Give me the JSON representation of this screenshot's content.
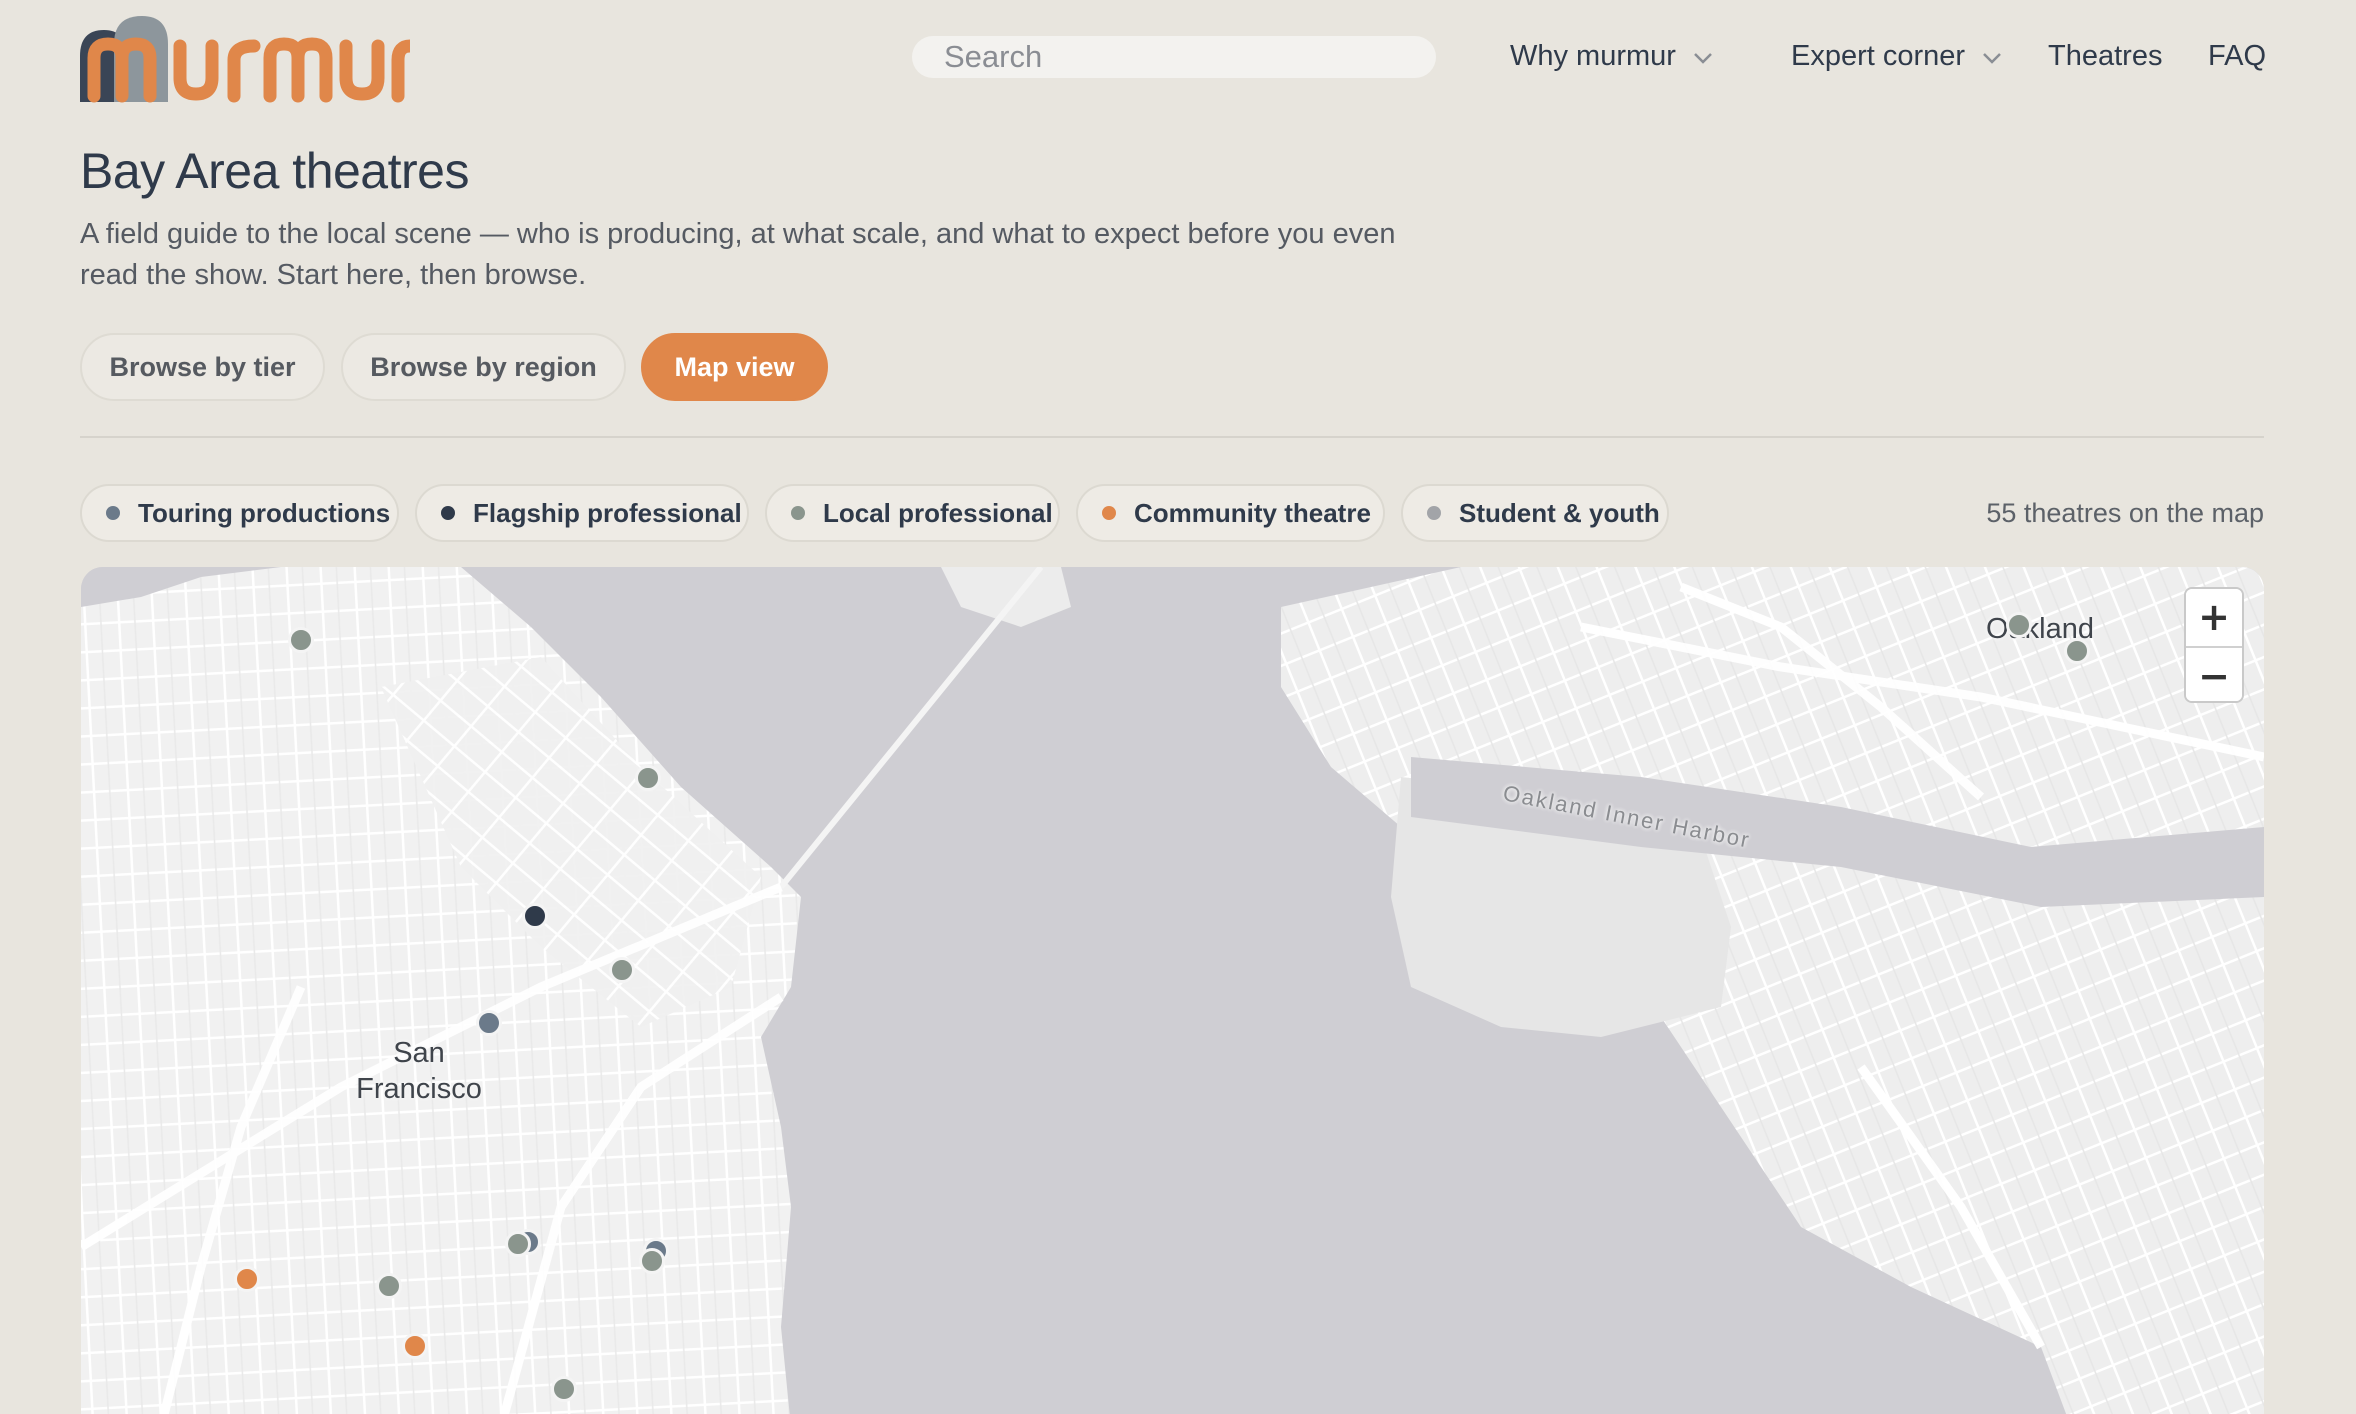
{
  "brand": {
    "name": "murmur"
  },
  "search": {
    "placeholder": "Search"
  },
  "nav": {
    "items": [
      {
        "label": "Why murmur",
        "dropdown": true
      },
      {
        "label": "Expert corner",
        "dropdown": true
      },
      {
        "label": "Theatres",
        "dropdown": false
      },
      {
        "label": "FAQ",
        "dropdown": false
      }
    ]
  },
  "page": {
    "title": "Bay Area theatres",
    "subtitle": "A field guide to the local scene — who is producing, at what scale, and what to expect before you even read the show. Start here, then browse."
  },
  "views": {
    "items": [
      {
        "label": "Browse by tier",
        "active": false
      },
      {
        "label": "Browse by region",
        "active": false
      },
      {
        "label": "Map view",
        "active": true
      }
    ]
  },
  "legend": {
    "items": [
      {
        "label": "Touring productions",
        "color": "#6b7a8a"
      },
      {
        "label": "Flagship professional",
        "color": "#2f3a4a"
      },
      {
        "label": "Local professional",
        "color": "#8a958d"
      },
      {
        "label": "Community theatre",
        "color": "#e0874a"
      },
      {
        "label": "Student & youth",
        "color": "#a2a4a8"
      }
    ],
    "count_text": "55 theatres on the map"
  },
  "map": {
    "labels": {
      "sf": "San Francisco",
      "oakland": "Oakland",
      "harbor": "Oakland Inner Harbor"
    },
    "zoom_in": "+",
    "zoom_out": "−",
    "colors": {
      "water": "#cfced3",
      "land": "#f2f2f2",
      "road": "#ffffff",
      "pin_local": "#8a958d",
      "pin_touring": "#6b7a8a",
      "pin_flagship": "#2f3a4a",
      "pin_community": "#e0874a"
    }
  }
}
